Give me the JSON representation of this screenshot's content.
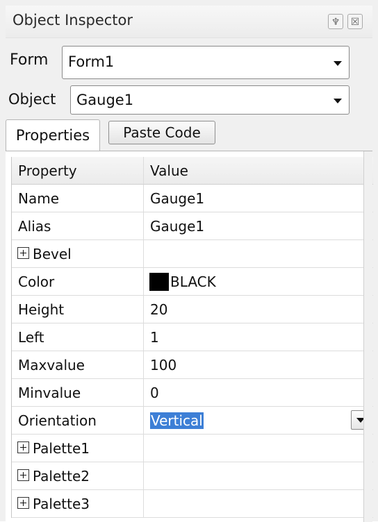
{
  "window": {
    "title": "Object Inspector",
    "pin_glyph": "♆",
    "close_glyph": "☒"
  },
  "form_selector": {
    "label": "Form",
    "value": "Form1"
  },
  "object_selector": {
    "label": "Object",
    "value": "Gauge1"
  },
  "tabs": {
    "properties": "Properties",
    "paste_code": "Paste Code"
  },
  "grid": {
    "columns": [
      "Property",
      "Value"
    ],
    "rows": [
      {
        "property": "Name",
        "value": "Gauge1",
        "expandable": false
      },
      {
        "property": "Alias",
        "value": "Gauge1",
        "expandable": false
      },
      {
        "property": "Bevel",
        "value": "",
        "expandable": true
      },
      {
        "property": "Color",
        "value": "BLACK",
        "expandable": false,
        "swatch": "#000000"
      },
      {
        "property": "Height",
        "value": "20",
        "expandable": false
      },
      {
        "property": "Left",
        "value": "1",
        "expandable": false
      },
      {
        "property": "Maxvalue",
        "value": "100",
        "expandable": false
      },
      {
        "property": "Minvalue",
        "value": "0",
        "expandable": false
      },
      {
        "property": "Orientation",
        "value": "Vertical",
        "expandable": false,
        "editing": true
      },
      {
        "property": "Palette1",
        "value": "",
        "expandable": true
      },
      {
        "property": "Palette2",
        "value": "",
        "expandable": true
      },
      {
        "property": "Palette3",
        "value": "",
        "expandable": true
      }
    ]
  },
  "colors": {
    "selection": "#3d7fd6",
    "panel_bg": "#f0f0f0"
  }
}
